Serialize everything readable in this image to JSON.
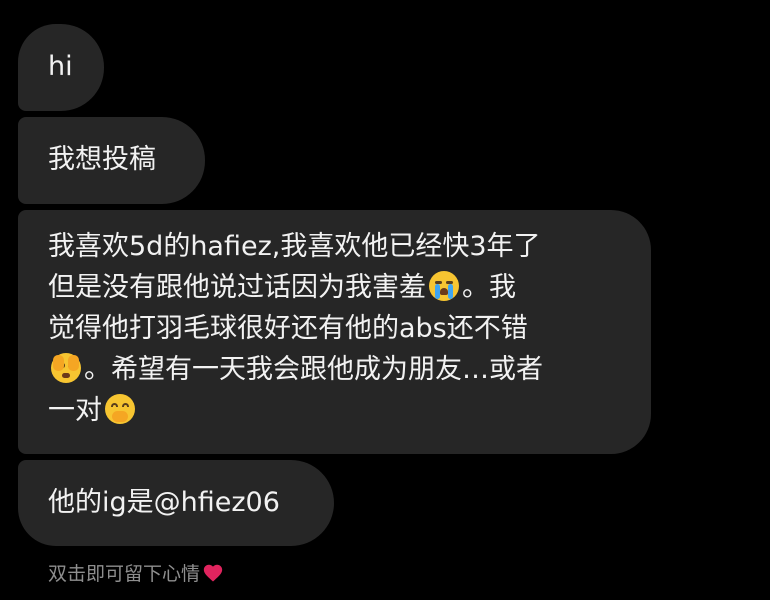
{
  "messages": [
    {
      "text": "hi"
    },
    {
      "text": "我想投稿"
    },
    {
      "lines": [
        {
          "text": "我喜欢5d的hafiez,我喜欢他已经快3年了"
        },
        {
          "before": "但是没有跟他说过话因为我害羞",
          "emoji": "loudly-crying-face-icon",
          "after": "。我"
        },
        {
          "text": "觉得他打羽毛球很好还有他的abs还不错"
        },
        {
          "emoji": "face-with-peeking-eye-icon",
          "after": "。希望有一天我会跟他成为朋友…或者"
        },
        {
          "before": "一对",
          "emoji": "face-with-hand-over-mouth-icon"
        }
      ]
    },
    {
      "text": "他的ig是@hfiez06"
    }
  ],
  "footer": {
    "hint": "双击即可留下心情",
    "heart_icon": "red-heart-icon",
    "heart_color": "#e0245e"
  },
  "colors": {
    "background": "#000000",
    "bubble": "#262626",
    "text": "#f2f2f2",
    "hint": "#8e8e8e"
  }
}
